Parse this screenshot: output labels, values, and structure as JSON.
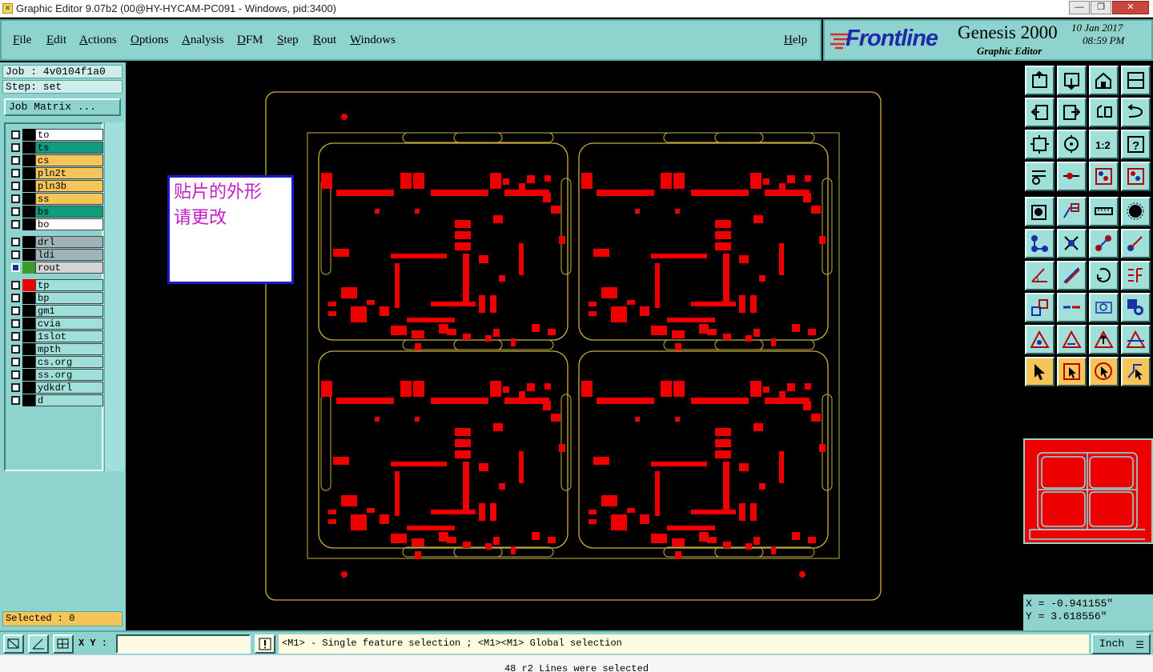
{
  "window": {
    "title": "Graphic Editor 9.07b2 (00@HY-HYCAM-PC091 - Windows, pid:3400)",
    "controls": [
      "minimize",
      "maximize",
      "close"
    ]
  },
  "menu": [
    {
      "label": "File"
    },
    {
      "label": "Edit"
    },
    {
      "label": "Actions"
    },
    {
      "label": "Options"
    },
    {
      "label": "Analysis"
    },
    {
      "label": "DFM"
    },
    {
      "label": "Step"
    },
    {
      "label": "Rout"
    },
    {
      "label": "Windows"
    }
  ],
  "help_label": "Help",
  "brand": {
    "logo": "Frontline",
    "product": "Genesis 2000",
    "subtitle": "Graphic Editor",
    "date": "10 Jan 2017",
    "time": "08:59 PM",
    "logo_color": "#1e2aa8",
    "logo_accent": "#e3262b"
  },
  "job": {
    "job_label": "Job : 4v0104f1a0",
    "step_label": "Step: set",
    "matrix_button": "Job Matrix ..."
  },
  "layers": [
    {
      "name": "to",
      "color": "#ffffff",
      "swatch": "#000000",
      "checked": false
    },
    {
      "name": "ts",
      "color": "#0f9c7c",
      "swatch": "#000000",
      "checked": false
    },
    {
      "name": "cs",
      "color": "#f6c55a",
      "swatch": "#000000",
      "checked": false
    },
    {
      "name": "pln2t",
      "color": "#f6c55a",
      "swatch": "#000000",
      "checked": false
    },
    {
      "name": "pln3b",
      "color": "#f6c55a",
      "swatch": "#000000",
      "checked": false
    },
    {
      "name": "ss",
      "color": "#f6c55a",
      "swatch": "#000000",
      "checked": false
    },
    {
      "name": "bs",
      "color": "#0f9c7c",
      "swatch": "#000000",
      "checked": false
    },
    {
      "name": "bo",
      "color": "#ffffff",
      "swatch": "#000000",
      "checked": false
    },
    {
      "name": "drl",
      "color": "#9fb4b8",
      "swatch": "#000000",
      "checked": false
    },
    {
      "name": "ldi",
      "color": "#9fb4b8",
      "swatch": "#000000",
      "checked": false
    },
    {
      "name": "rout",
      "color": "#d4d4d4",
      "swatch": "#3a9c2a",
      "checked": true
    },
    {
      "name": "tp",
      "color": "#9fe0da",
      "swatch": "#ee0000",
      "checked": false
    },
    {
      "name": "bp",
      "color": "#9fe0da",
      "swatch": "#000000",
      "checked": false
    },
    {
      "name": "gm1",
      "color": "#9fe0da",
      "swatch": "#000000",
      "checked": false
    },
    {
      "name": "cvia",
      "color": "#9fe0da",
      "swatch": "#000000",
      "checked": false
    },
    {
      "name": "1slot",
      "color": "#9fe0da",
      "swatch": "#000000",
      "checked": false
    },
    {
      "name": "mpth",
      "color": "#9fe0da",
      "swatch": "#000000",
      "checked": false
    },
    {
      "name": "cs.org",
      "color": "#9fe0da",
      "swatch": "#000000",
      "checked": false
    },
    {
      "name": "ss.org",
      "color": "#9fe0da",
      "swatch": "#000000",
      "checked": false
    },
    {
      "name": "ydkdrl",
      "color": "#9fe0da",
      "swatch": "#000000",
      "checked": false
    },
    {
      "name": "d",
      "color": "#9fe0da",
      "swatch": "#000000",
      "checked": false
    }
  ],
  "selected_label": "Selected : 0",
  "note": {
    "line1": "贴片的外形",
    "line2": "请更改"
  },
  "coords": {
    "x": "X = -0.941155\"",
    "y": "Y = 3.618556\""
  },
  "xy_label": "X Y :",
  "xy_value": "",
  "hint": "<M1> - Single feature selection ; <M1><M1> Global selection",
  "unit": "Inch",
  "status": "48 r2 Lines were selected",
  "colors": {
    "pcb_copper": "#ee0000",
    "outline": "#c8b040",
    "panel_bg": "#8fd3ce"
  },
  "tools": [
    {
      "name": "zoom-home-icon"
    },
    {
      "name": "zoom-down-icon"
    },
    {
      "name": "home-icon"
    },
    {
      "name": "window-icon"
    },
    {
      "name": "pan-left-icon"
    },
    {
      "name": "pan-right-icon"
    },
    {
      "name": "undo-icon"
    },
    {
      "name": "redo-icon"
    },
    {
      "name": "fit-icon"
    },
    {
      "name": "center-icon"
    },
    {
      "name": "one-to-one-icon"
    },
    {
      "name": "help-icon"
    },
    {
      "name": "measure-icon"
    },
    {
      "name": "snap-icon"
    },
    {
      "name": "layer-icon"
    },
    {
      "name": "layer-active-icon"
    },
    {
      "name": "point-icon"
    },
    {
      "name": "polygon-icon"
    },
    {
      "name": "ruler-icon"
    },
    {
      "name": "pad-icon"
    },
    {
      "name": "move-icon"
    },
    {
      "name": "cross-icon"
    },
    {
      "name": "connect-icon"
    },
    {
      "name": "arrow-icon"
    },
    {
      "name": "angle-icon"
    },
    {
      "name": "line-icon"
    },
    {
      "name": "arc-icon"
    },
    {
      "name": "split-icon"
    },
    {
      "name": "copy-icon"
    },
    {
      "name": "dash-icon"
    },
    {
      "name": "target-icon"
    },
    {
      "name": "group-icon"
    },
    {
      "name": "tri-left-icon"
    },
    {
      "name": "tri-up-icon"
    },
    {
      "name": "tri-arrow-icon"
    },
    {
      "name": "tri-right-icon"
    },
    {
      "name": "select-icon",
      "active": true
    },
    {
      "name": "select-box-icon"
    },
    {
      "name": "select-arrow-icon"
    },
    {
      "name": "select-chain-icon"
    }
  ]
}
